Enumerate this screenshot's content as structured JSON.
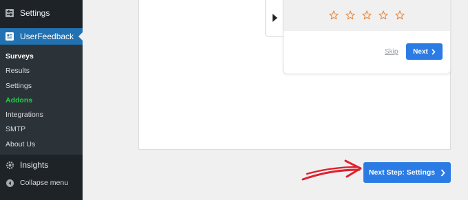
{
  "sidebar": {
    "settings_label": "Settings",
    "plugin_label": "UserFeedback",
    "submenu": [
      {
        "label": "Surveys"
      },
      {
        "label": "Results"
      },
      {
        "label": "Settings"
      },
      {
        "label": "Addons"
      },
      {
        "label": "Integrations"
      },
      {
        "label": "SMTP"
      },
      {
        "label": "About Us"
      }
    ],
    "insights_label": "Insights",
    "collapse_label": "Collapse menu"
  },
  "survey_preview": {
    "rating_icon": "star-outline-icon",
    "rating_count": 5,
    "skip_label": "Skip",
    "next_label": "Next"
  },
  "footer": {
    "next_step_label": "Next Step: Settings"
  },
  "colors": {
    "sidebar_bg": "#1d2327",
    "submenu_bg": "#2c3338",
    "active_menu": "#2271b1",
    "addons_green": "#1ed14b",
    "button_blue": "#2b7be4",
    "star_orange": "#e8883a",
    "annotation_red": "#e0202c"
  }
}
